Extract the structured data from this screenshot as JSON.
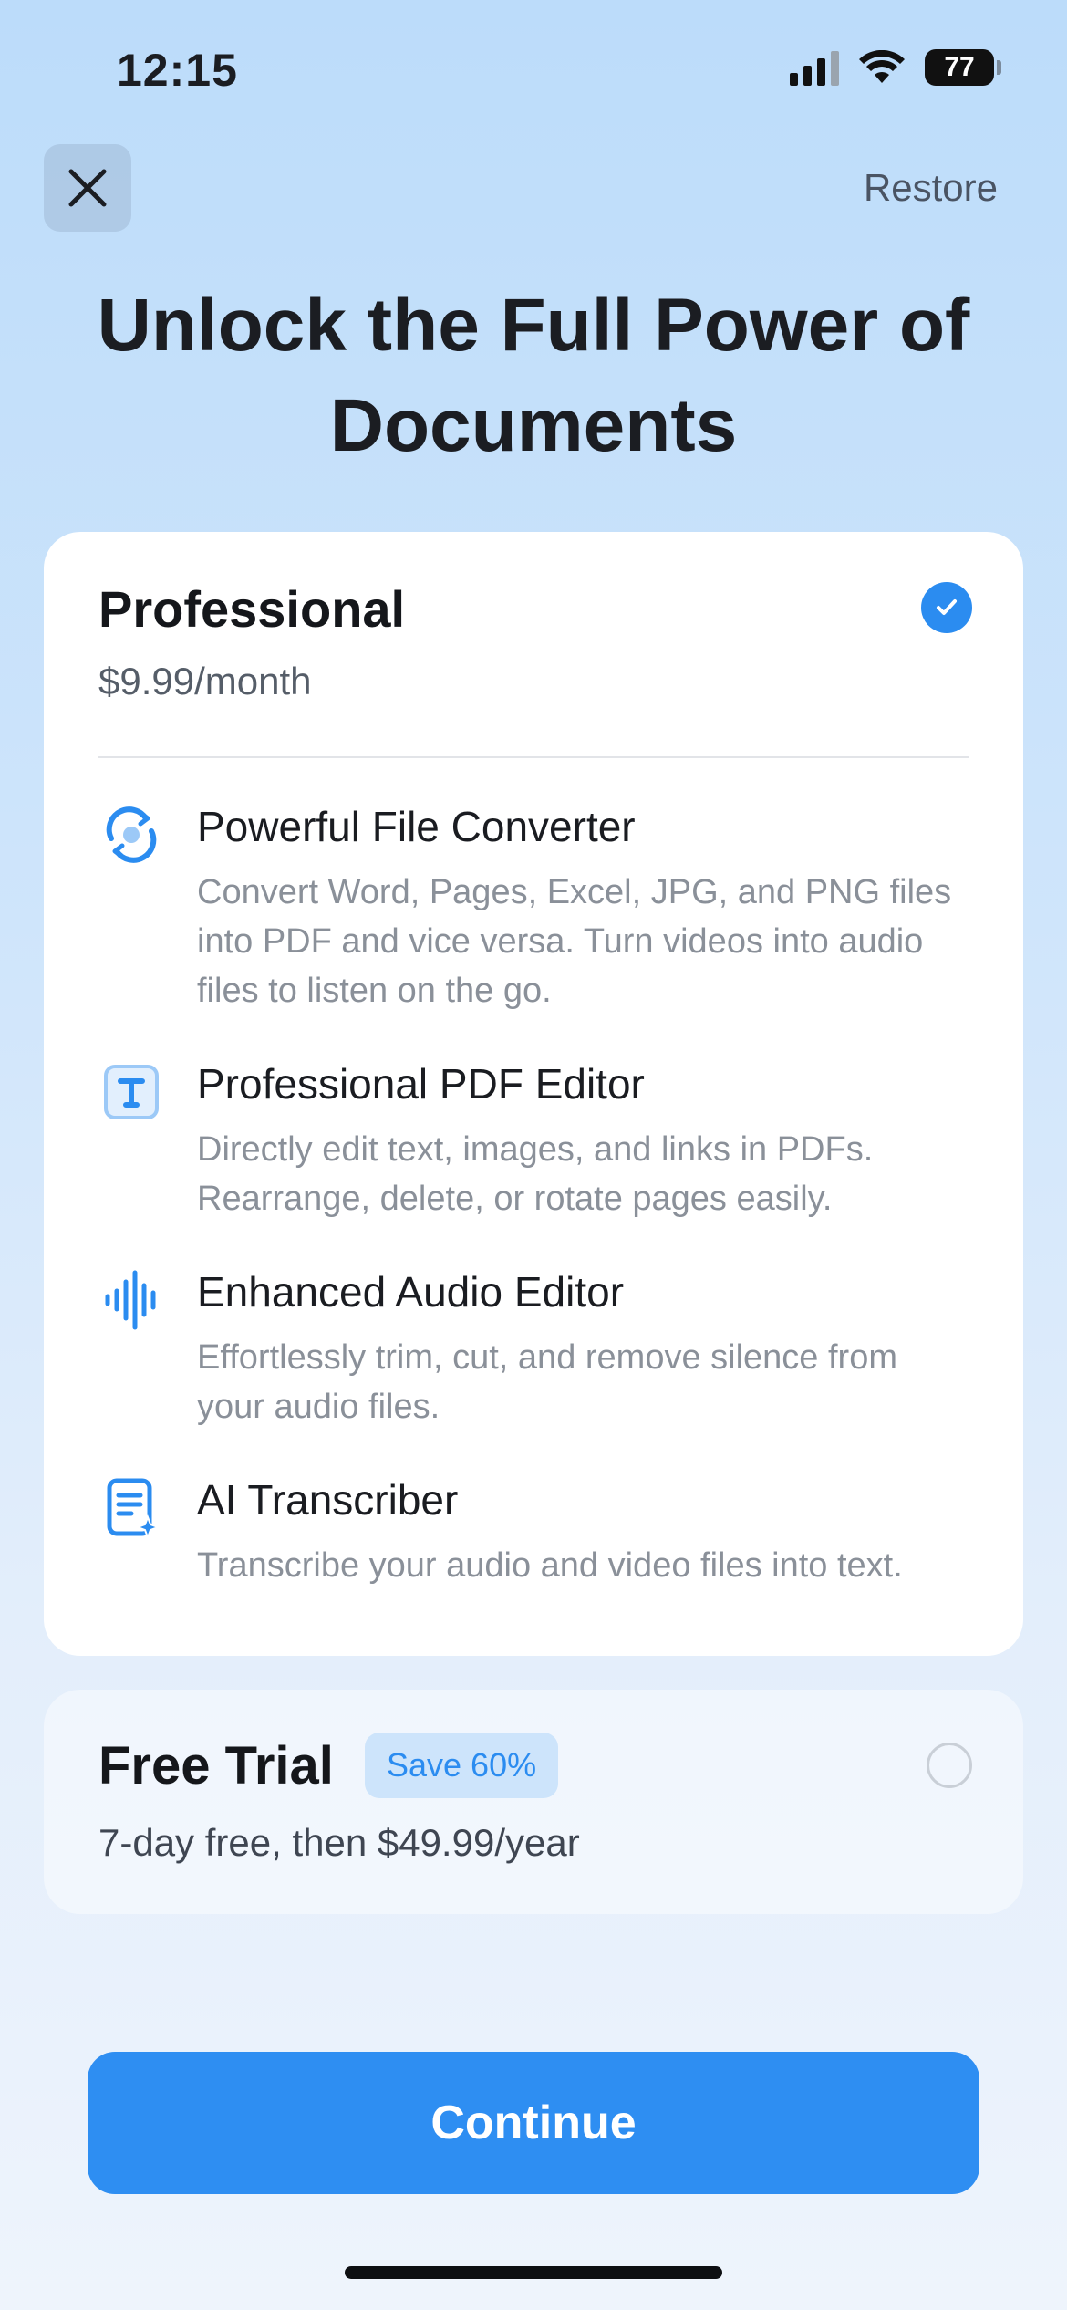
{
  "status_bar": {
    "time": "12:15",
    "battery": "77",
    "signal_icon": "cellular-signal-icon",
    "wifi_icon": "wifi-icon"
  },
  "header": {
    "close_icon": "close-icon",
    "restore_label": "Restore"
  },
  "title": {
    "line1": "Unlock the Full Power of",
    "line2": "Documents"
  },
  "plans": {
    "professional": {
      "name": "Professional",
      "price": "$9.99/month",
      "selected": true,
      "features": [
        {
          "icon": "converter-icon",
          "title": "Powerful File Converter",
          "description": "Convert Word, Pages, Excel, JPG, and PNG files into PDF and vice versa. Turn videos into audio files to listen on the go."
        },
        {
          "icon": "text-edit-icon",
          "title": "Professional PDF Editor",
          "description": "Directly edit text, images, and links in PDFs. Rearrange, delete, or rotate pages easily."
        },
        {
          "icon": "audio-waveform-icon",
          "title": "Enhanced Audio Editor",
          "description": "Effortlessly trim, cut, and remove silence from your audio files."
        },
        {
          "icon": "ai-document-icon",
          "title": "AI Transcriber",
          "description": "Transcribe your audio and video files into text."
        }
      ]
    },
    "free_trial": {
      "name": "Free Trial",
      "badge": "Save 60%",
      "price": "7-day free, then $49.99/year",
      "selected": false
    }
  },
  "cta": {
    "continue_label": "Continue"
  },
  "colors": {
    "accent": "#2e8ef2",
    "badge_bg": "#cde4fb",
    "text_primary": "#1b1d22",
    "text_secondary": "#8a9099"
  }
}
